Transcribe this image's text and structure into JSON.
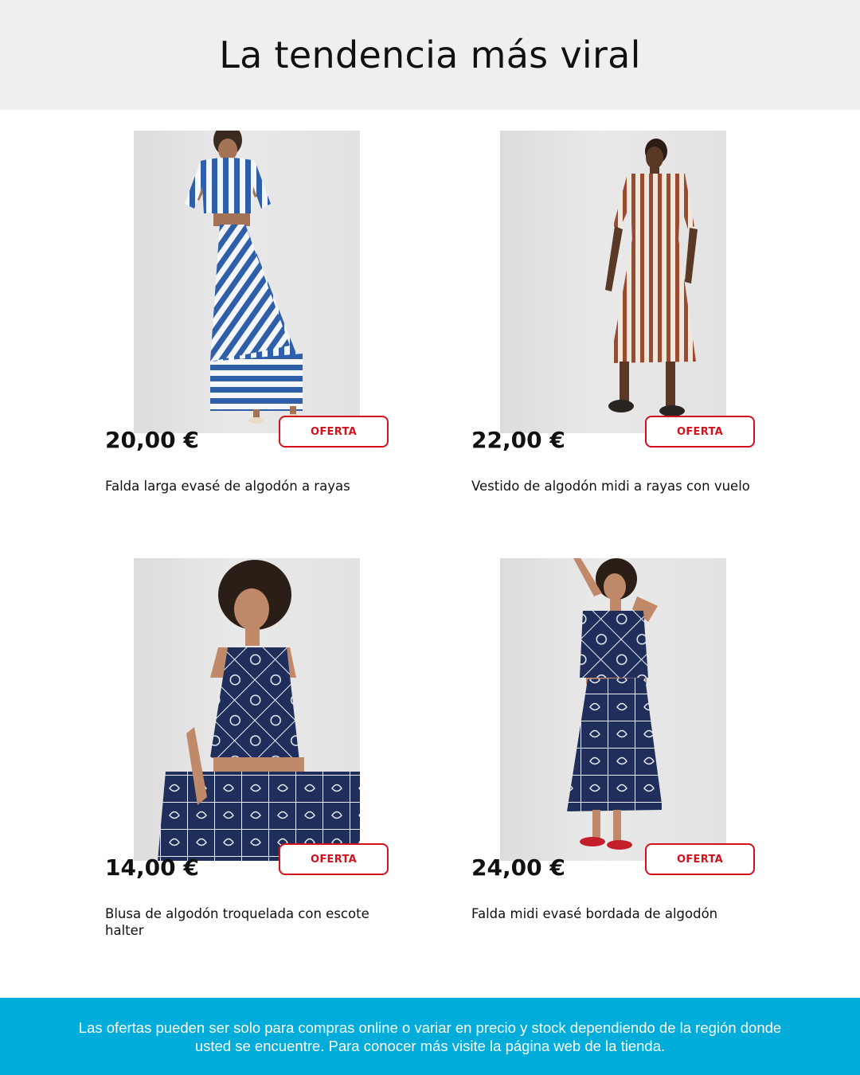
{
  "header": {
    "title": "La tendencia más viral"
  },
  "products": [
    {
      "price": "20,00 €",
      "badge": "OFERTA",
      "title": "Falda larga evasé de algodón a rayas",
      "image": "model-blue-white-striped-two-piece"
    },
    {
      "price": "22,00 €",
      "badge": "OFERTA",
      "title": "Vestido de algodón midi a rayas con vuelo",
      "image": "model-brown-striped-midi-dress"
    },
    {
      "price": "14,00 €",
      "badge": "OFERTA",
      "title": "Blusa de algodón troquelada con escote halter",
      "image": "model-navy-shell-print-halter-top"
    },
    {
      "price": "24,00 €",
      "badge": "OFERTA",
      "title": "Falda midi evasé bordada de algodón",
      "image": "model-navy-shell-print-midi-skirt"
    }
  ],
  "footer": {
    "disclaimer": "Las ofertas pueden ser solo para compras online o variar en precio y stock dependiendo de la región donde usted se encuentre. Para conocer más visite la página web de la tienda."
  },
  "colors": {
    "accent_red": "#d4101c",
    "footer_blue": "#00acd9",
    "header_gray": "#efefef"
  }
}
